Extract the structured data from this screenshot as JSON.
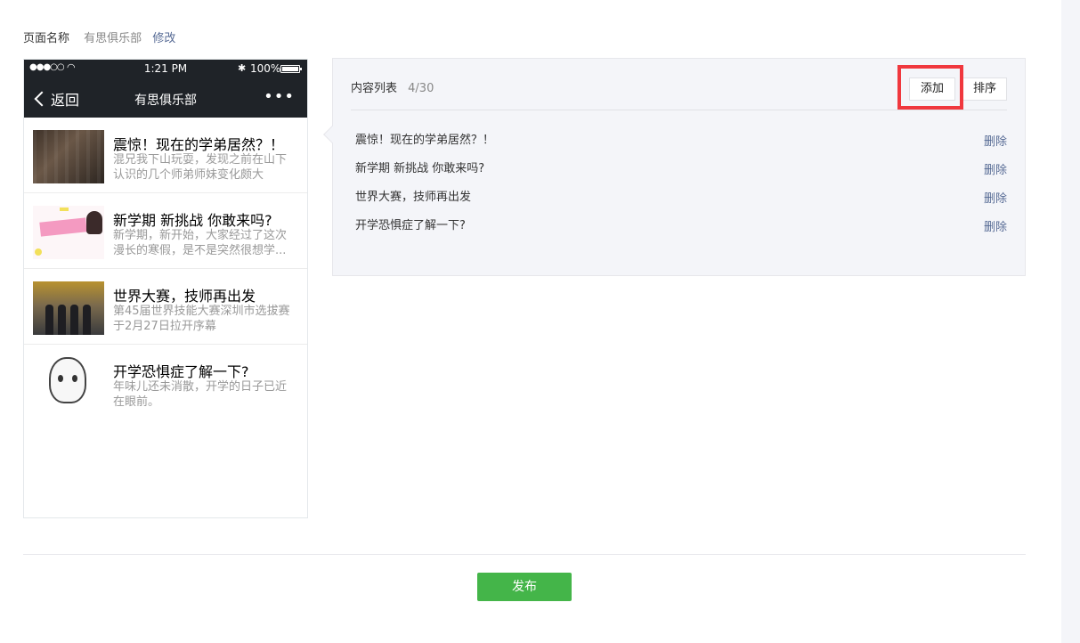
{
  "page_name": {
    "label": "页面名称",
    "value": "有思俱乐部",
    "edit_label": "修改"
  },
  "phone": {
    "status": {
      "signal": "●●●○○",
      "time": "1:21 PM",
      "battery_pct": "100%"
    },
    "nav": {
      "back_label": "返回",
      "title": "有思俱乐部",
      "more": "•••"
    },
    "articles": [
      {
        "title": "震惊！现在的学弟居然？！",
        "desc": "混兄我下山玩耍，发现之前在山下认识的几个师弟师妹变化颇大"
      },
      {
        "title": "新学期 新挑战 你敢来吗?",
        "desc": "新学期，新开始，大家经过了这次漫长的寒假，是不是突然很想学..."
      },
      {
        "title": "世界大赛，技师再出发",
        "desc": "第45届世界技能大赛深圳市选拔赛于2月27日拉开序幕"
      },
      {
        "title": "开学恐惧症了解一下?",
        "desc": "年味儿还未消散，开学的日子已近在眼前。"
      }
    ]
  },
  "content_list": {
    "label": "内容列表",
    "count": "4/30",
    "add_label": "添加",
    "sort_label": "排序",
    "items": [
      {
        "title": "震惊！现在的学弟居然？！",
        "delete_label": "删除"
      },
      {
        "title": "新学期 新挑战 你敢来吗?",
        "delete_label": "删除"
      },
      {
        "title": "世界大赛，技师再出发",
        "delete_label": "删除"
      },
      {
        "title": "开学恐惧症了解一下?",
        "delete_label": "删除"
      }
    ]
  },
  "publish_label": "发布",
  "colors": {
    "accent_green": "#44b549",
    "link_blue": "#576b95",
    "highlight_red": "#f0383e",
    "phone_bar": "#1f2328"
  }
}
